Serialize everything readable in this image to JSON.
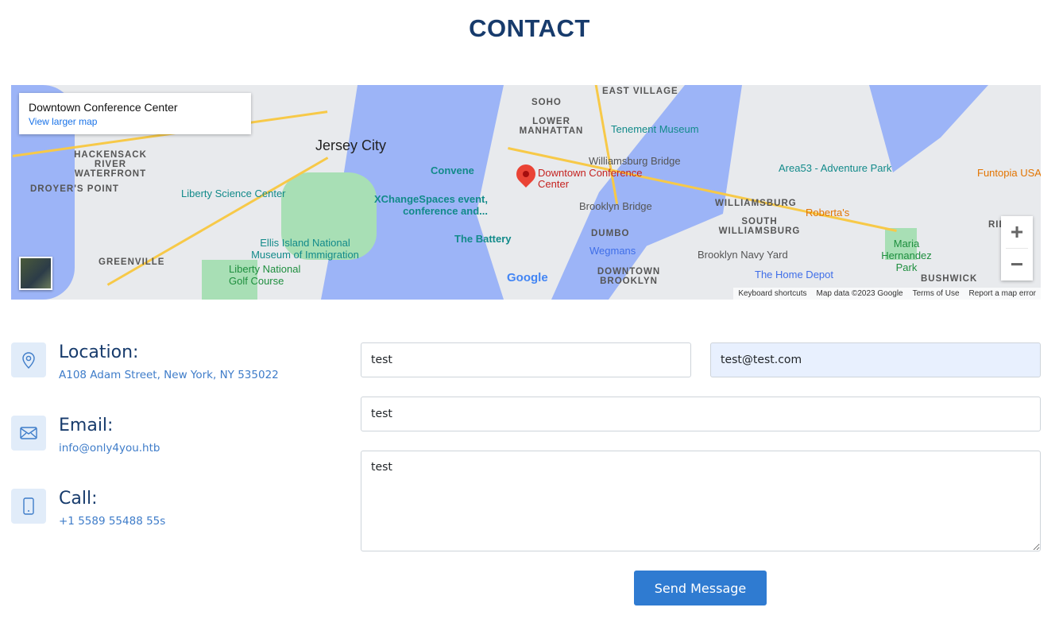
{
  "section_title": "CONTACT",
  "map": {
    "place_title": "Downtown Conference Center",
    "view_larger": "View larger map",
    "marker_label": "Downtown Conference Center",
    "labels": {
      "jersey_city": "Jersey City",
      "hackensack": "HACKENSACK RIVER WATERFRONT",
      "droyers": "DROYER'S POINT",
      "greenville": "GREENVILLE",
      "liberty_sci": "Liberty Science Center",
      "ellis": "Ellis Island National Museum of Immigration",
      "liberty_golf": "Liberty National Golf Course",
      "convene": "Convene",
      "xchange": "XChangeSpaces event, conference and...",
      "battery": "The Battery",
      "soho": "SOHO",
      "east_village": "EAST VILLAGE",
      "lower_manhattan": "LOWER MANHATTAN",
      "tenement": "Tenement Museum",
      "williamsburg_bridge": "Williamsburg Bridge",
      "brooklyn_bridge": "Brooklyn Bridge",
      "dumbo": "DUMBO",
      "wegmans": "Wegmans",
      "downtown_brooklyn": "DOWNTOWN BROOKLYN",
      "navy_yard": "Brooklyn Navy Yard",
      "home_depot": "The Home Depot",
      "williamsburg": "WILLIAMSBURG",
      "south_williamsburg": "SOUTH WILLIAMSBURG",
      "robertas": "Roberta's",
      "area53": "Area53 - Adventure Park",
      "funtopia": "Funtopia USA",
      "maria": "Maria Hernandez Park",
      "bushwick": "BUSHWICK",
      "ridgewood": "RIDG"
    },
    "zoom_in": "+",
    "zoom_out": "−",
    "attribution": [
      "Keyboard shortcuts",
      "Map data ©2023 Google",
      "Terms of Use",
      "Report a map error"
    ],
    "google_logo": "Google"
  },
  "info": {
    "location": {
      "title": "Location:",
      "value": "A108 Adam Street, New York, NY 535022",
      "icon": "map-pin-icon"
    },
    "email": {
      "title": "Email:",
      "value": "info@only4you.htb",
      "icon": "envelope-icon"
    },
    "call": {
      "title": "Call:",
      "value": "+1 5589 55488 55s",
      "icon": "phone-icon"
    }
  },
  "form": {
    "name": "test",
    "email": "test@test.com",
    "subject": "test",
    "message": "test",
    "submit": "Send Message"
  }
}
